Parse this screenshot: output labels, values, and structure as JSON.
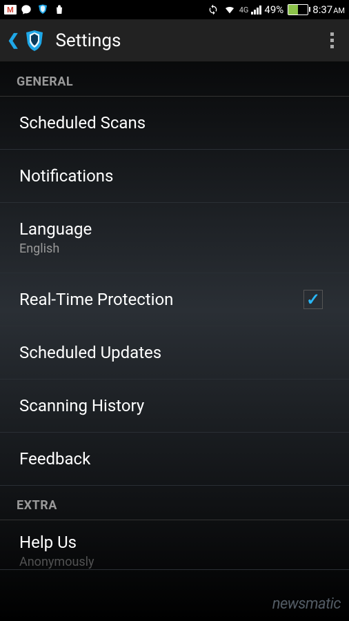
{
  "status_bar": {
    "battery_percent": "49%",
    "time": "8:37",
    "time_suffix": "AM",
    "network_label": "4G"
  },
  "action_bar": {
    "title": "Settings"
  },
  "sections": {
    "general": {
      "header": "GENERAL",
      "items": {
        "scheduled_scans": {
          "title": "Scheduled Scans"
        },
        "notifications": {
          "title": "Notifications"
        },
        "language": {
          "title": "Language",
          "subtitle": "English"
        },
        "realtime_protection": {
          "title": "Real-Time Protection",
          "checked": true
        },
        "scheduled_updates": {
          "title": "Scheduled Updates"
        },
        "scanning_history": {
          "title": "Scanning History"
        },
        "feedback": {
          "title": "Feedback"
        }
      }
    },
    "extra": {
      "header": "EXTRA",
      "items": {
        "help_us": {
          "title": "Help Us",
          "subtitle": "Anonymously"
        }
      }
    }
  },
  "watermark": "newsmatic"
}
